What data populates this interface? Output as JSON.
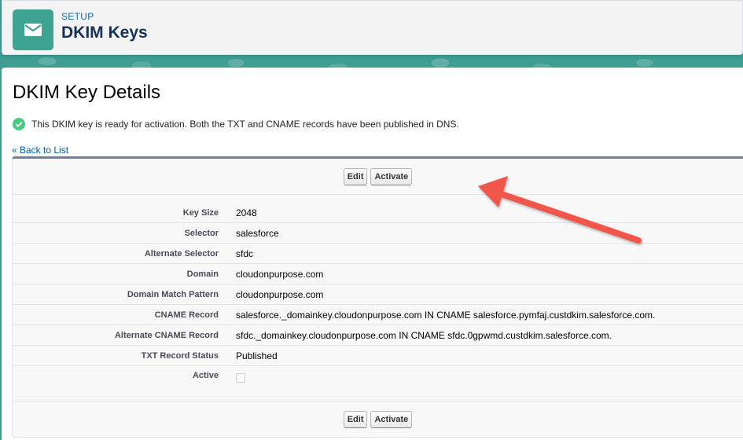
{
  "header": {
    "eyebrow": "SETUP",
    "title": "DKIM Keys",
    "icon": "envelope-icon"
  },
  "page": {
    "title": "DKIM Key Details",
    "status_message": "This DKIM key is ready for activation. Both the TXT and CNAME records have been published in DNS.",
    "back_link": "« Back to List"
  },
  "buttons": {
    "edit": "Edit",
    "activate": "Activate"
  },
  "fields": [
    {
      "label": "Key Size",
      "value": "2048"
    },
    {
      "label": "Selector",
      "value": "salesforce"
    },
    {
      "label": "Alternate Selector",
      "value": "sfdc"
    },
    {
      "label": "Domain",
      "value": "cloudonpurpose.com"
    },
    {
      "label": "Domain Match Pattern",
      "value": "cloudonpurpose.com"
    },
    {
      "label": "CNAME Record",
      "value": "salesforce._domainkey.cloudonpurpose.com IN CNAME salesforce.pymfaj.custdkim.salesforce.com."
    },
    {
      "label": "Alternate CNAME Record",
      "value": "sfdc._domainkey.cloudonpurpose.com IN CNAME sfdc.0gpwmd.custdkim.salesforce.com."
    },
    {
      "label": "TXT Record Status",
      "value": "Published"
    }
  ],
  "active_field": {
    "label": "Active",
    "checked": false
  },
  "colors": {
    "brand_teal": "#3fa392",
    "link": "#015ba7",
    "success": "#4bca81",
    "annotation_arrow": "#f0574a"
  }
}
